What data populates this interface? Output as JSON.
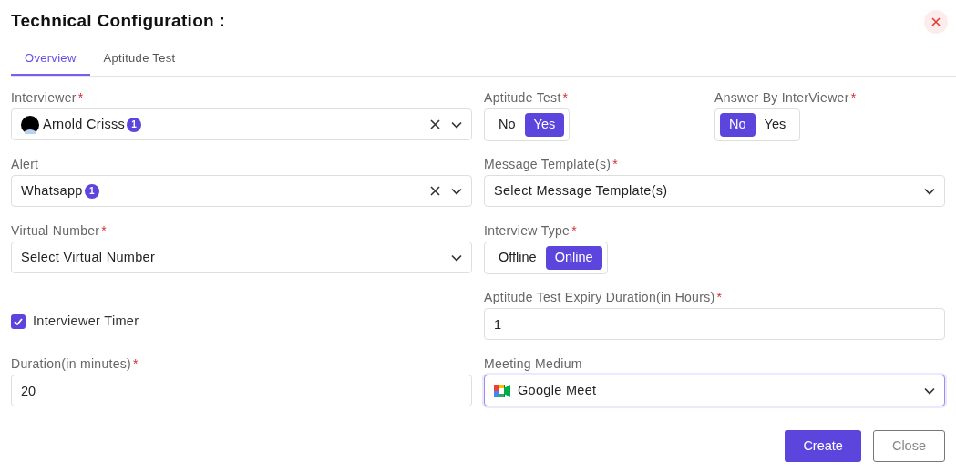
{
  "title": "Technical Configuration :",
  "tabs": [
    {
      "label": "Overview",
      "selected": true
    },
    {
      "label": "Aptitude Test",
      "selected": false
    }
  ],
  "left": [
    {
      "kind": "person_select",
      "label": "Interviewer",
      "required_mark": "*",
      "value": "Arnold Crisss",
      "badge": "1",
      "clearable": true
    },
    {
      "kind": "select",
      "label": "Alert",
      "value": "Whatsapp",
      "badge": "1",
      "clearable": true
    },
    {
      "kind": "select",
      "label": "Virtual Number",
      "required_mark": "*",
      "value": "Select Virtual Number",
      "clearable": false
    },
    {
      "kind": "checkbox",
      "label": "Interviewer Timer",
      "checked": true
    },
    {
      "kind": "input",
      "label": "Duration(in minutes)",
      "required_mark": "*",
      "value": "20"
    }
  ],
  "right": [
    {
      "kind": "toggles",
      "groups": [
        {
          "label": "Aptitude Test",
          "required_mark": "*",
          "options": [
            {
              "label": "No",
              "selected": false
            },
            {
              "label": "Yes",
              "selected": true
            }
          ]
        },
        {
          "label": "Answer By InterViewer",
          "required_mark": "*",
          "options": [
            {
              "label": "No",
              "selected": true
            },
            {
              "label": "Yes",
              "selected": false
            }
          ]
        }
      ]
    },
    {
      "kind": "select",
      "label": "Message Template(s)",
      "required_mark": "*",
      "value": "Select Message Template(s)",
      "clearable": false
    },
    {
      "kind": "toggles",
      "groups": [
        {
          "label": "Interview Type",
          "required_mark": "*",
          "options": [
            {
              "label": "Offline",
              "selected": false
            },
            {
              "label": "Online",
              "selected": true
            }
          ]
        }
      ]
    },
    {
      "kind": "input",
      "label": "Aptitude Test Expiry Duration(in Hours)",
      "required_mark": "*",
      "value": "1"
    },
    {
      "kind": "video_select",
      "label": "Meeting Medium",
      "value": "Google Meet",
      "clearable": false,
      "focused": true
    }
  ],
  "buttons": [
    {
      "label": "Create",
      "kind": "primary"
    },
    {
      "label": "Close",
      "kind": "secondary"
    }
  ]
}
